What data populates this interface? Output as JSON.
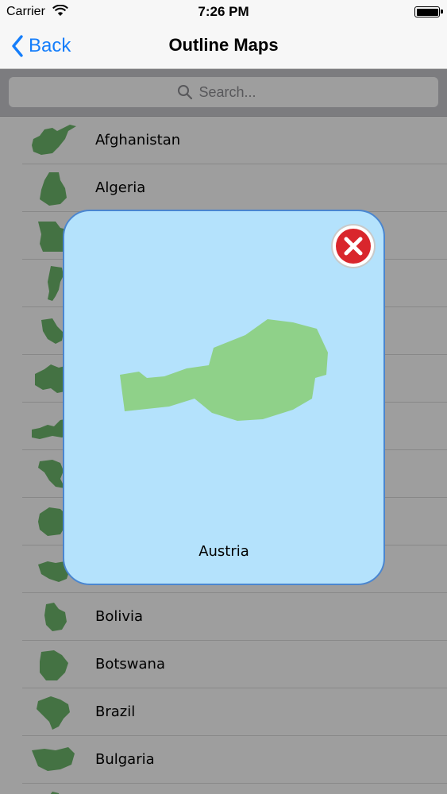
{
  "status_bar": {
    "carrier": "Carrier",
    "time": "7:26 PM"
  },
  "nav": {
    "back_label": "Back",
    "title": "Outline Maps"
  },
  "search": {
    "placeholder": "Search..."
  },
  "countries": [
    {
      "name": "Afghanistan",
      "icon": "afghanistan-outline-icon"
    },
    {
      "name": "Algeria",
      "icon": "algeria-outline-icon"
    },
    {
      "name": "",
      "icon": "angola-outline-icon"
    },
    {
      "name": "",
      "icon": "argentina-outline-icon"
    },
    {
      "name": "",
      "icon": "armenia-outline-icon"
    },
    {
      "name": "",
      "icon": "australia-outline-icon"
    },
    {
      "name": "",
      "icon": "austria-outline-icon"
    },
    {
      "name": "",
      "icon": "bangladesh-outline-icon"
    },
    {
      "name": "",
      "icon": "belarus-outline-icon"
    },
    {
      "name": "",
      "icon": "belgium-outline-icon"
    },
    {
      "name": "Bolivia",
      "icon": "bolivia-outline-icon"
    },
    {
      "name": "Botswana",
      "icon": "botswana-outline-icon"
    },
    {
      "name": "Brazil",
      "icon": "brazil-outline-icon"
    },
    {
      "name": "Bulgaria",
      "icon": "bulgaria-outline-icon"
    },
    {
      "name": "",
      "icon": "burkina-outline-icon"
    }
  ],
  "modal": {
    "country_name": "Austria",
    "map_color": "#8fd189",
    "background_color": "#b4e2fc",
    "close_color": "#d9262c"
  },
  "colors": {
    "accent": "#157efb",
    "map_fill": "#6fb86c"
  }
}
